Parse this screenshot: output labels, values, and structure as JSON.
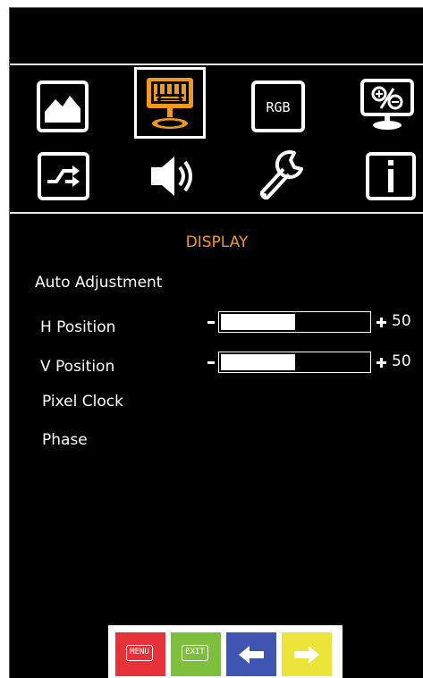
{
  "menu": {
    "title": "DISPLAY",
    "selected_icon": "display-icon",
    "icons": [
      "picture-icon",
      "display-icon",
      "rgb-icon",
      "pip-icon",
      "input-icon",
      "audio-icon",
      "setup-icon",
      "info-icon"
    ],
    "rgb_icon_text": "RGB"
  },
  "items": {
    "auto_adjustment": "Auto Adjustment",
    "h_position": {
      "label": "H Position",
      "value": "50",
      "level_percent": 50
    },
    "v_position": {
      "label": "V Position",
      "value": "50",
      "level_percent": 50
    },
    "pixel_clock": "Pixel Clock",
    "phase": "Phase"
  },
  "buttons": {
    "menu": {
      "label": "MENU",
      "color": "#e8323a"
    },
    "exit": {
      "label": "EXIT",
      "color": "#7ec03e"
    },
    "left": {
      "icon": "arrow-left-icon",
      "color": "#3e55b2"
    },
    "right": {
      "icon": "arrow-right-icon",
      "color": "#ece43a"
    }
  },
  "colors": {
    "accent": "#f09a1c",
    "background": "#000000",
    "text": "#ffffff"
  }
}
